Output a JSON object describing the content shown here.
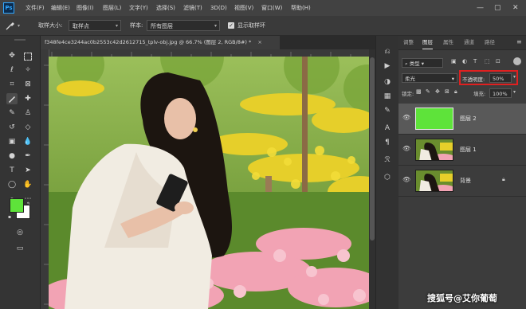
{
  "app": {
    "logo_text": "Ps"
  },
  "menu": [
    "文件(F)",
    "编辑(E)",
    "图像(I)",
    "图层(L)",
    "文字(Y)",
    "选择(S)",
    "滤镜(T)",
    "3D(D)",
    "视图(V)",
    "窗口(W)",
    "帮助(H)"
  ],
  "window_controls": {
    "minimize": "—",
    "maximize": "▢",
    "close": "✕"
  },
  "options": {
    "sample_size_label": "取样大小:",
    "sample_size_value": "取样点",
    "sample_label": "样本:",
    "sample_value": "所有图层",
    "show_ring_label": "显示取样环",
    "show_ring_checked": true
  },
  "document": {
    "tab_title": "f348fe4ce3244ac0b2553c42d2612715_tplv-obj.jpg @ 66.7% (图层 2, RGB/8#) *",
    "close": "×"
  },
  "panel": {
    "tabs": [
      "调整",
      "图层",
      "属性",
      "通道",
      "路径"
    ],
    "active_tab": "图层",
    "filter_label": "类型",
    "blend_mode": "柔光",
    "opacity_label": "不透明度:",
    "opacity_value": "50%",
    "lock_label": "锁定:",
    "fill_label": "填充:",
    "fill_value": "100%",
    "layers": [
      {
        "name": "图层 2",
        "selected": true,
        "thumb": "green"
      },
      {
        "name": "图层 1",
        "selected": false,
        "thumb": "photo"
      },
      {
        "name": "背景",
        "selected": false,
        "thumb": "photo",
        "locked": true
      }
    ]
  },
  "colors": {
    "foreground": "#5ee33a",
    "background": "#ffffff",
    "highlight": "#e02020",
    "layer2_fill": "#5ee33a"
  },
  "watermark": "搜狐号@艾你葡萄"
}
